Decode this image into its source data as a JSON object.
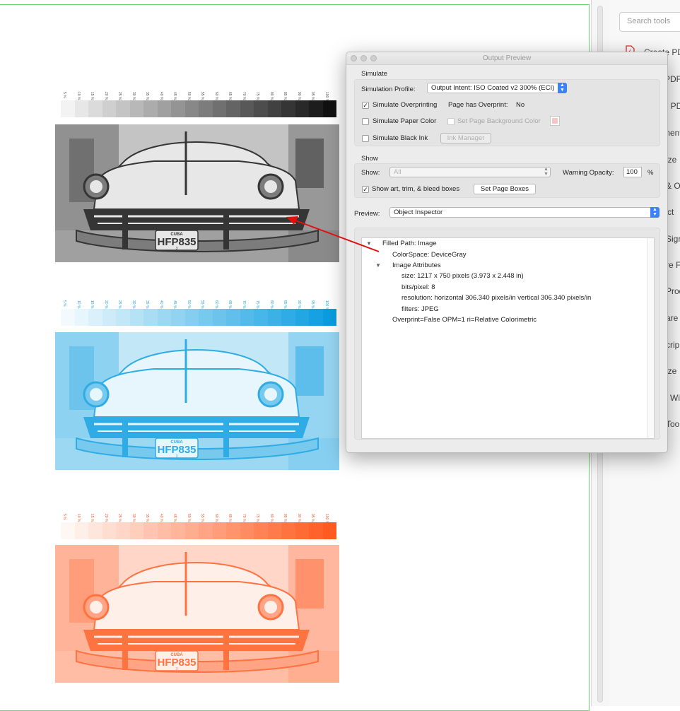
{
  "tone_ramp": {
    "labels": [
      "5",
      "10",
      "15",
      "20",
      "25",
      "30",
      "35",
      "40",
      "45",
      "50",
      "55",
      "60",
      "65",
      "70",
      "75",
      "80",
      "85",
      "90",
      "95",
      "100"
    ],
    "unit": "%",
    "levels": [
      0.05,
      0.1,
      0.15,
      0.2,
      0.25,
      0.3,
      0.35,
      0.4,
      0.45,
      0.5,
      0.55,
      0.6,
      0.65,
      0.7,
      0.75,
      0.8,
      0.85,
      0.9,
      0.95,
      1.0
    ]
  },
  "panels": [
    {
      "ink": "#111111",
      "text": "#555555"
    },
    {
      "ink": "#0a9de0",
      "text": "#1a9fd9"
    },
    {
      "ink": "#ff5a1f",
      "text": "#e85a2a"
    }
  ],
  "plate": {
    "top": "CUBA",
    "number": "HFP835",
    "bottom": "3"
  },
  "tools_pane": {
    "search_placeholder": "Search tools",
    "items": [
      "Create PD",
      "PDF",
      ": PD",
      "ment",
      "ize",
      "& O",
      "ct",
      "Sign",
      "re F",
      "Prod",
      "are",
      "crip",
      "ize",
      "Wi",
      "Too"
    ]
  },
  "dialog": {
    "title": "Output Preview",
    "simulate": {
      "section": "Simulate",
      "profile_label": "Simulation Profile:",
      "profile_value": "Output Intent: ISO Coated v2 300% (ECI)",
      "overprinting_label": "Simulate Overprinting",
      "overprinting_checked": true,
      "has_overprint_label": "Page has Overprint:",
      "has_overprint_value": "No",
      "paper_color_label": "Simulate Paper Color",
      "paper_color_checked": false,
      "page_bg_label": "Set Page Background Color",
      "black_ink_label": "Simulate Black Ink",
      "black_ink_checked": false,
      "ink_manager_label": "Ink Manager"
    },
    "show": {
      "section": "Show",
      "show_label": "Show:",
      "show_value": "All",
      "warning_label": "Warning Opacity:",
      "warning_value": "100",
      "warning_unit": "%",
      "boxes_label": "Show art, trim, & bleed boxes",
      "boxes_checked": true,
      "set_boxes_label": "Set Page Boxes"
    },
    "preview": {
      "label": "Preview:",
      "value": "Object Inspector"
    },
    "inspector": {
      "filled_path": "Filled Path: Image",
      "colorspace": "ColorSpace: DeviceGray",
      "image_attributes": "Image Attributes",
      "size": "size: 1217 x 750 pixels (3.973 x 2.448 in)",
      "bits": "bits/pixel: 8",
      "resolution": "resolution: horizontal 306.340 pixels/in vertical 306.340 pixels/in",
      "filters": "filters: JPEG",
      "overprint": "Overprint=False OPM=1 ri=Relative Colorimetric"
    }
  },
  "colors": {
    "accent": "#3b82f6",
    "arrow": "#e01010",
    "page_border": "#6fd66f"
  }
}
